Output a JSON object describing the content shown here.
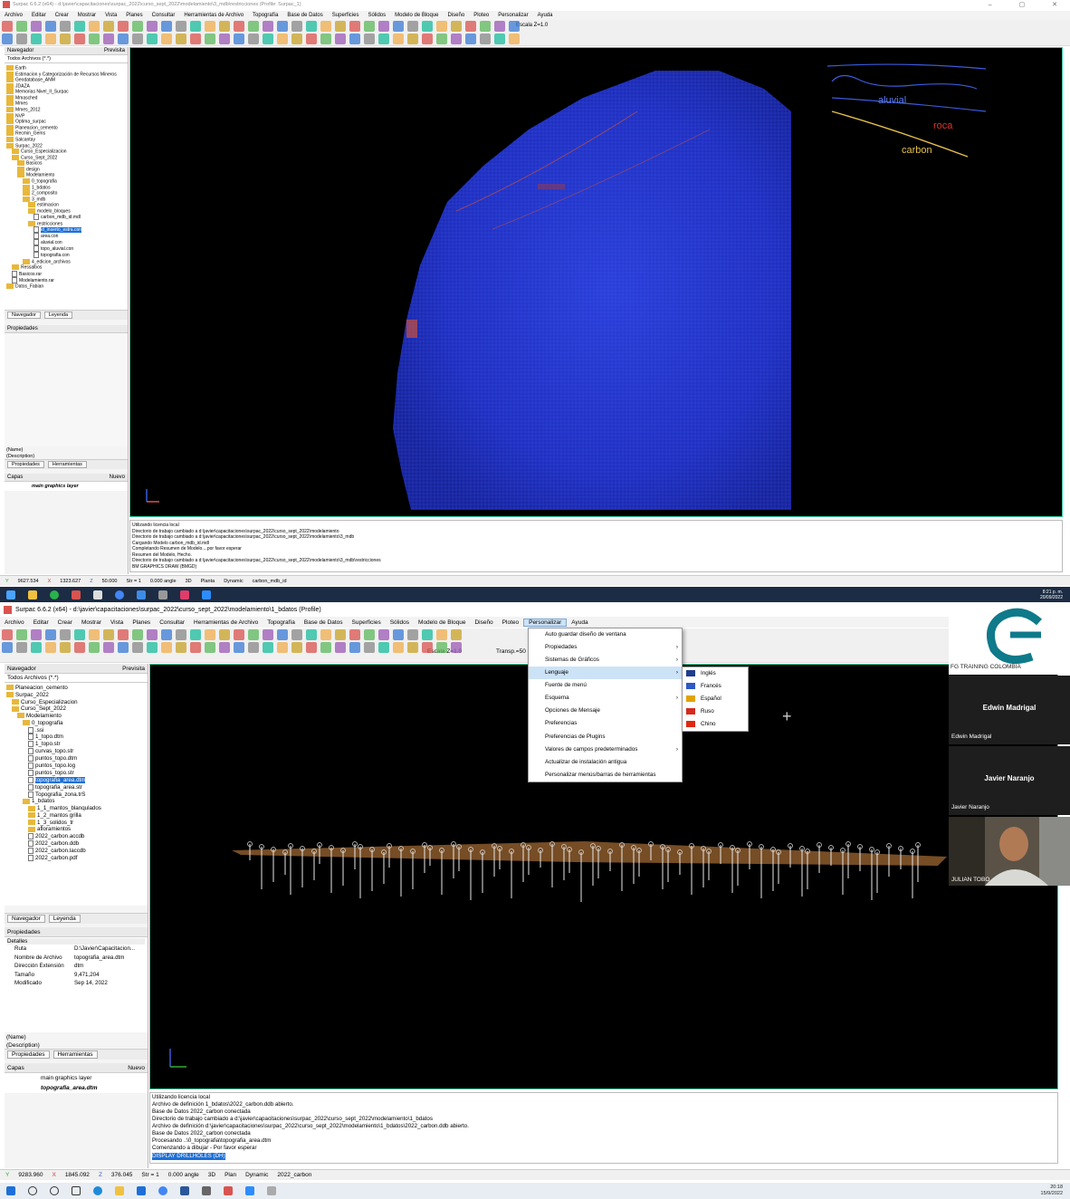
{
  "top": {
    "title": "Surpac 6.6.2 (x64) - d:\\javier\\capacitaciones\\surpac_2022\\curso_sept_2022\\modelamiento\\3_mdb\\restricciones (Profile: Surpac_1)",
    "menu": [
      "Archivo",
      "Editar",
      "Crear",
      "Mostrar",
      "Vista",
      "Planes",
      "Consultar",
      "Herramientas de Archivo",
      "Topografía",
      "Base de Datos",
      "Superficies",
      "Sólidos",
      "Modelo de Bloque",
      "Diseño",
      "Ploteo",
      "Personalizar",
      "Ayuda"
    ],
    "escala": "Escala Z=1.0",
    "navigator_title": "Navegador",
    "preview_label": "Previsita",
    "filter": "Todos Archivos (*.*)",
    "tree": [
      "Earth",
      "Estimacion y Categorización de Recursos Mineros",
      "Geodatabase_ANM",
      "JDAZA",
      "Memorias Nivel_II_Surpac",
      "Mmasched",
      "Mmes",
      "Mmes_2012",
      "NVP",
      "Optima_surpac",
      "Planeacion_cemento",
      "Recmin_Gems",
      "Salcantay",
      "Surpac_2022",
      "Curso_Especializacion",
      "Curso_Sept_2022",
      "Basicos",
      "design",
      "Modelamiento",
      "0_topografia",
      "1_bdatos",
      "2_composito",
      "3_mdb",
      "estimacion",
      "modelo_bloques",
      "carbon_mdb_id.mdl",
      "restricciones",
      "id_inserto_estra.con",
      "area.con",
      "aluvial.con",
      "topo_aluvial.con",
      "topografia.con",
      "4_edicion_archivos",
      "Ressalbos",
      "Basicos.rar",
      "Modelamiento.rar",
      "Datos_Fabian"
    ],
    "tree_selected_index": 27,
    "tab_navegador": "Navegador",
    "tab_leyenda": "Leyenda",
    "propiedades": "Propiedades",
    "name_label": "(Name)",
    "description_label": "(Description)",
    "tab_propiedades": "Propiedades",
    "tab_herramientas": "Herramientas",
    "capas": "Capas",
    "nuevo": "Nuevo",
    "layer": "main graphics layer",
    "legend": {
      "aluvial": "aluvial",
      "roca": "roca",
      "carbon": "carbon"
    },
    "log": [
      "Utilizando licencia local",
      "Directorio de trabajo cambiado a d:\\javier\\capacitaciones\\surpac_2022\\curso_sept_2022\\modelamiento",
      "Directorio de trabajo cambiado a d:\\javier\\capacitaciones\\surpac_2022\\curso_sept_2022\\modelamiento\\3_mdb",
      "Cargando Modelo carbon_mdb_id.mdl",
      "Completando Resumen de Modelo....por favor esperar",
      "Resumen del Modelo, Hecho.",
      "Directorio de trabajo cambiado a d:\\javier\\capacitaciones\\surpac_2022\\curso_sept_2022\\modelamiento\\3_mdb\\restricciones",
      "BM GRAPHICS DRAW (BMGD)"
    ],
    "status": {
      "y": "9627.534",
      "x": "1323.627",
      "z": "50.000",
      "str": "Str = 1",
      "angle": "0.000 angle",
      "view": "3D",
      "mode": "Planta",
      "dyn": "Dynamic",
      "model": "carbon_mdb_id"
    },
    "clock_time": "8:21 p. m.",
    "clock_date": "20/09/2022"
  },
  "bottom": {
    "title": "Surpac 6.6.2 (x64) - d:\\javier\\capacitaciones\\surpac_2022\\curso_sept_2022\\modelamiento\\1_bdatos (Profile)",
    "menu": [
      "Archivo",
      "Editar",
      "Crear",
      "Mostrar",
      "Vista",
      "Planes",
      "Consultar",
      "Herramientas de Archivo",
      "Topografía",
      "Base de Datos",
      "Superficies",
      "Sólidos",
      "Modelo de Bloque",
      "Diseño",
      "Ploteo",
      "Personalizar",
      "Ayuda"
    ],
    "menu_active_index": 15,
    "escala": "Escala Z=1.0",
    "transp": "Transp.=50",
    "navigator_title": "Navegador",
    "preview_label": "Previsita",
    "filter": "Todos Archivos (*.*)",
    "tree": [
      "Planeacion_cemento",
      "Surpac_2022",
      "Curso_Especializacion",
      "Curso_Sept_2022",
      "Modelamiento",
      "0_topografia",
      ".ssi",
      "1_topo.dtm",
      "1_topo.str",
      "curvas_topo.str",
      "puntos_topo.dtm",
      "puntos_topo.log",
      "puntos_topo.str",
      "topografia_area.dtm",
      "topografia_area.str",
      "Topografia_zona.trS",
      "1_bdatos",
      "1_1_mantos_blanqulados",
      "1_2_mantos grilla",
      "1_3_solidos_tr",
      "afloramientos",
      "2022_carbon.accdb",
      "2022_carbon.ddb",
      "2022_carbon.laccdb",
      "2022_carbon.pdf"
    ],
    "tree_selected_index": 13,
    "tab_navegador": "Navegador",
    "tab_leyenda": "Leyenda",
    "propiedades": "Propiedades",
    "detalles": "Detalles",
    "props": [
      {
        "k": "Ruta",
        "v": "D:\\Javier\\Capacitacion..."
      },
      {
        "k": "Nombre de Archivo",
        "v": "topografia_area.dtm"
      },
      {
        "k": "Dirección Extensión",
        "v": "dtm"
      },
      {
        "k": "Tamaño",
        "v": "9,471,204"
      },
      {
        "k": "Modificado",
        "v": "Sep 14, 2022"
      }
    ],
    "name_label": "(Name)",
    "description_label": "(Description)",
    "tab_propiedades": "Propiedades",
    "tab_herramientas": "Herramientas",
    "capas": "Capas",
    "nuevo": "Nuevo",
    "layer1": "main graphics layer",
    "layer2": "topografia_area.dtm",
    "personalizar_menu": [
      {
        "label": "Auto guardar diseño de ventana",
        "sub": false
      },
      {
        "label": "Propiedades",
        "sub": true
      },
      {
        "label": "Sistemas de Gráficos",
        "sub": true
      },
      {
        "label": "Lenguaje",
        "sub": true
      },
      {
        "label": "Fuente de menú",
        "sub": false
      },
      {
        "label": "Esquema",
        "sub": true
      },
      {
        "label": "Opciones de Mensaje",
        "sub": false
      },
      {
        "label": "Preferencias",
        "sub": false
      },
      {
        "label": "Preferencias de Plugins",
        "sub": false
      },
      {
        "label": "Valores de campos predeterminados",
        "sub": true
      },
      {
        "label": "Actualizar de instalación antigua",
        "sub": false
      },
      {
        "label": "Personalizar menús/barras de herramientas",
        "sub": false
      }
    ],
    "languages": [
      {
        "label": "Inglés",
        "color": "#1f3d8f"
      },
      {
        "label": "Francés",
        "color": "#2f59c4"
      },
      {
        "label": "Español",
        "color": "#e0a400"
      },
      {
        "label": "Ruso",
        "color": "#d52b1e"
      },
      {
        "label": "Chino",
        "color": "#de2910"
      }
    ],
    "log": [
      "Utilizando licencia local",
      "Archivo de definición 1_bdatos\\2022_carbon.ddb abierto.",
      "Base de Datos 2022_carbon conectada",
      "Directorio de trabajo cambiado a d:\\javier\\capacitaciones\\surpac_2022\\curso_sept_2022\\modelamiento\\1_bdatos",
      "Archivo de definición d:\\javier\\capacitaciones\\surpac_2022\\curso_sept_2022\\modelamiento\\1_bdatos\\2022_carbon.ddb abierto.",
      "Base de Datos 2022_carbon conectada",
      "Procesando ..\\0_topografia\\topografia_area.dtm",
      "Comenzando a dibujar - Por favor esperar",
      "DISPLAY DRILLHOLES (DH)"
    ],
    "status": {
      "y": "9283.960",
      "x": "1845.092",
      "z": "376.045",
      "str": "Str = 1",
      "angle": "0.000 angle",
      "view": "3D",
      "mode": "Plan",
      "dyn": "Dynamic",
      "model": "2022_carbon"
    },
    "clock_time": "20:18",
    "clock_date": "15/9/2022"
  },
  "video": {
    "logo_label": "FG TRAINING COLOMBIA",
    "p1_big": "Edwin Madrigal",
    "p1_small": "Edwin Madrigal",
    "p2_big": "Javier Naranjo",
    "p2_small": "Javier Naranjo",
    "p3_small": "JULIAN TOBO"
  }
}
